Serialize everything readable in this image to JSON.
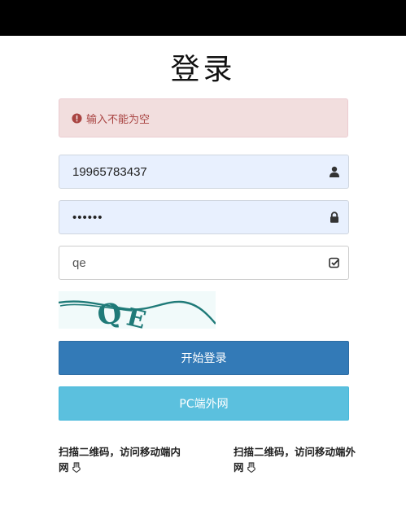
{
  "page": {
    "title": "登录",
    "alert": {
      "icon": "exclamation-circle-icon",
      "text": "输入不能为空"
    },
    "username": {
      "value": "19965783437",
      "icon": "user-icon"
    },
    "password": {
      "value": "123456",
      "icon": "lock-icon"
    },
    "captcha_input": {
      "value": "qe",
      "icon": "check-square-icon"
    },
    "captcha_image": {
      "text": "QE"
    },
    "buttons": {
      "login": "开始登录",
      "pc": "PC端外网"
    },
    "qr_links": [
      {
        "text": "扫描二维码，访问移动端内网",
        "icon": "hand-pointer-down-icon"
      },
      {
        "text": "扫描二维码，访问移动端外网",
        "icon": "hand-pointer-down-icon"
      }
    ]
  },
  "colors": {
    "alert_bg": "#f2dede",
    "alert_text": "#a94442",
    "input_autofill_bg": "#e8f0fe",
    "primary": "#337ab7",
    "info": "#5bc0de",
    "captcha_ink": "#1f7a78"
  }
}
